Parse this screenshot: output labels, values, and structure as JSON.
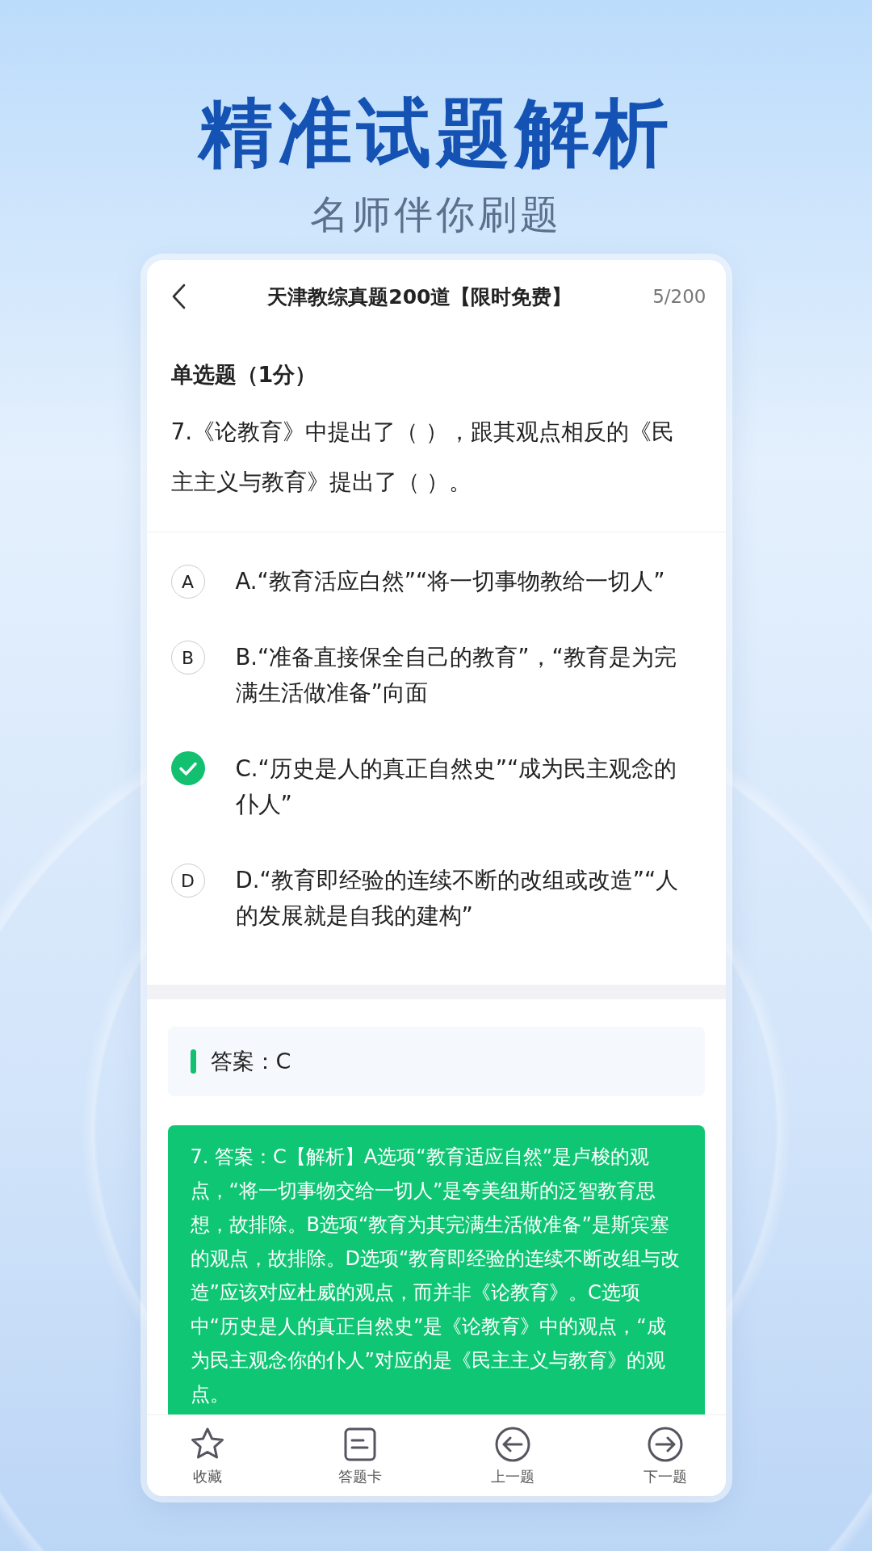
{
  "headline": "精准试题解析",
  "subheadline": "名师伴你刷题",
  "nav": {
    "title": "天津教综真题200道【限时免费】",
    "progress": "5/200"
  },
  "question": {
    "type_label": "单选题（1分）",
    "text": "7.《论教育》中提出了（ ），跟其观点相反的《民主主义与教育》提出了（ ）。"
  },
  "options": [
    {
      "letter": "A",
      "text": "A.“教育活应白然”“将一切事物教给一切人”",
      "selected": false
    },
    {
      "letter": "B",
      "text": "B.“准备直接保全自己的教育”，“教育是为完满生活做准备”向面",
      "selected": false
    },
    {
      "text": "C.“历史是人的真正自然史”“成为民主观念的仆人”",
      "selected": true
    },
    {
      "letter": "D",
      "text": "D.“教育即经验的连续不断的改组或改造”“人的发展就是自我的建构”",
      "selected": false
    }
  ],
  "answer": {
    "text": "答案：C"
  },
  "explanation": "7. 答案：C【解析】A选项“教育适应自然”是卢梭的观点，“将一切事物交给一切人”是夸美纽斯的泛智教育思想，故排除。B选项“教育为其完满生活做准备”是斯宾塞的观点，故排除。D选项“教育即经验的连续不断改组与改造”应该对应杜威的观点，而并非《论教育》。C选项中“历史是人的真正自然史”是《论教育》中的观点，“成为民主观念你的仆人”对应的是《民主主义与教育》的观点。",
  "toolbar": [
    {
      "kind": "star",
      "label": "收藏"
    },
    {
      "kind": "card",
      "label": "答题卡"
    },
    {
      "kind": "prev",
      "label": "上一题"
    },
    {
      "kind": "next",
      "label": "下一题"
    }
  ]
}
